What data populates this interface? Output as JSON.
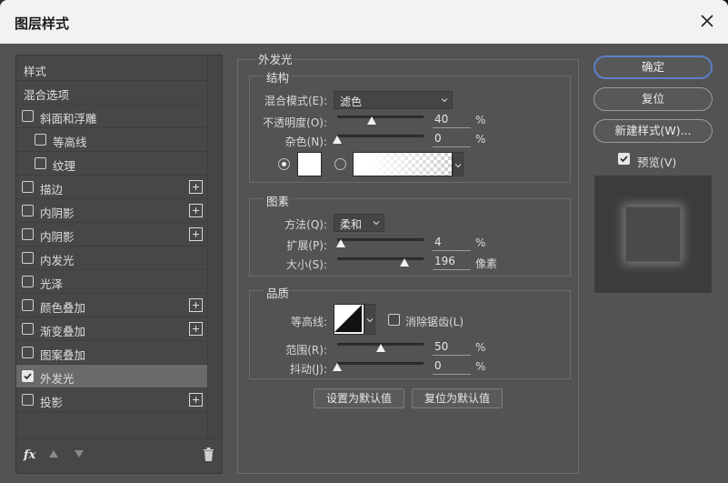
{
  "window": {
    "title": "图层样式"
  },
  "style_list": {
    "items": [
      {
        "label": "样式",
        "checkbox": false,
        "checked": false,
        "plus": false,
        "selected": false,
        "indent": false
      },
      {
        "label": "混合选项",
        "checkbox": false,
        "checked": false,
        "plus": false,
        "selected": false,
        "indent": false
      },
      {
        "label": "斜面和浮雕",
        "checkbox": true,
        "checked": false,
        "plus": false,
        "selected": false,
        "indent": false
      },
      {
        "label": "等高线",
        "checkbox": true,
        "checked": false,
        "plus": false,
        "selected": false,
        "indent": true
      },
      {
        "label": "纹理",
        "checkbox": true,
        "checked": false,
        "plus": false,
        "selected": false,
        "indent": true
      },
      {
        "label": "描边",
        "checkbox": true,
        "checked": false,
        "plus": true,
        "selected": false,
        "indent": false
      },
      {
        "label": "内阴影",
        "checkbox": true,
        "checked": false,
        "plus": true,
        "selected": false,
        "indent": false
      },
      {
        "label": "内阴影",
        "checkbox": true,
        "checked": false,
        "plus": true,
        "selected": false,
        "indent": false
      },
      {
        "label": "内发光",
        "checkbox": true,
        "checked": false,
        "plus": false,
        "selected": false,
        "indent": false
      },
      {
        "label": "光泽",
        "checkbox": true,
        "checked": false,
        "plus": false,
        "selected": false,
        "indent": false
      },
      {
        "label": "颜色叠加",
        "checkbox": true,
        "checked": false,
        "plus": true,
        "selected": false,
        "indent": false
      },
      {
        "label": "渐变叠加",
        "checkbox": true,
        "checked": false,
        "plus": true,
        "selected": false,
        "indent": false
      },
      {
        "label": "图案叠加",
        "checkbox": true,
        "checked": false,
        "plus": false,
        "selected": false,
        "indent": false
      },
      {
        "label": "外发光",
        "checkbox": true,
        "checked": true,
        "plus": false,
        "selected": true,
        "indent": false
      },
      {
        "label": "投影",
        "checkbox": true,
        "checked": false,
        "plus": true,
        "selected": false,
        "indent": false
      }
    ],
    "footer": {
      "fx_label": "fx"
    }
  },
  "outer_glow": {
    "section_title": "外发光",
    "structure": {
      "title": "结构",
      "blend_mode_label": "混合模式(E):",
      "blend_mode_value": "滤色",
      "opacity_label": "不透明度(O):",
      "opacity_value": "40",
      "opacity_unit": "%",
      "opacity": 40,
      "noise_label": "杂色(N):",
      "noise_value": "0",
      "noise_unit": "%",
      "noise": 0,
      "color_mode": "solid",
      "swatch_color": "#ffffff"
    },
    "elements": {
      "title": "图素",
      "technique_label": "方法(Q):",
      "technique_value": "柔和",
      "spread_label": "扩展(P):",
      "spread_value": "4",
      "spread_unit": "%",
      "spread": 4,
      "size_label": "大小(S):",
      "size_value": "196",
      "size_unit": "像素",
      "size_fraction": 0.784
    },
    "quality": {
      "title": "品质",
      "contour_label": "等高线:",
      "anti_alias_label": "消除锯齿(L)",
      "anti_alias_checked": false,
      "range_label": "范围(R):",
      "range_value": "50",
      "range_unit": "%",
      "range": 50,
      "jitter_label": "抖动(J):",
      "jitter_value": "0",
      "jitter_unit": "%",
      "jitter": 0
    },
    "buttons": {
      "make_default": "设置为默认值",
      "reset_default": "复位为默认值"
    }
  },
  "right": {
    "ok": "确定",
    "reset": "复位",
    "new_style": "新建样式(W)...",
    "preview_label": "预览(V)",
    "preview_checked": true
  },
  "colors": {
    "accent": "#5b7fc8",
    "panel": "#535353",
    "titlebar": "#f2f2f2"
  }
}
